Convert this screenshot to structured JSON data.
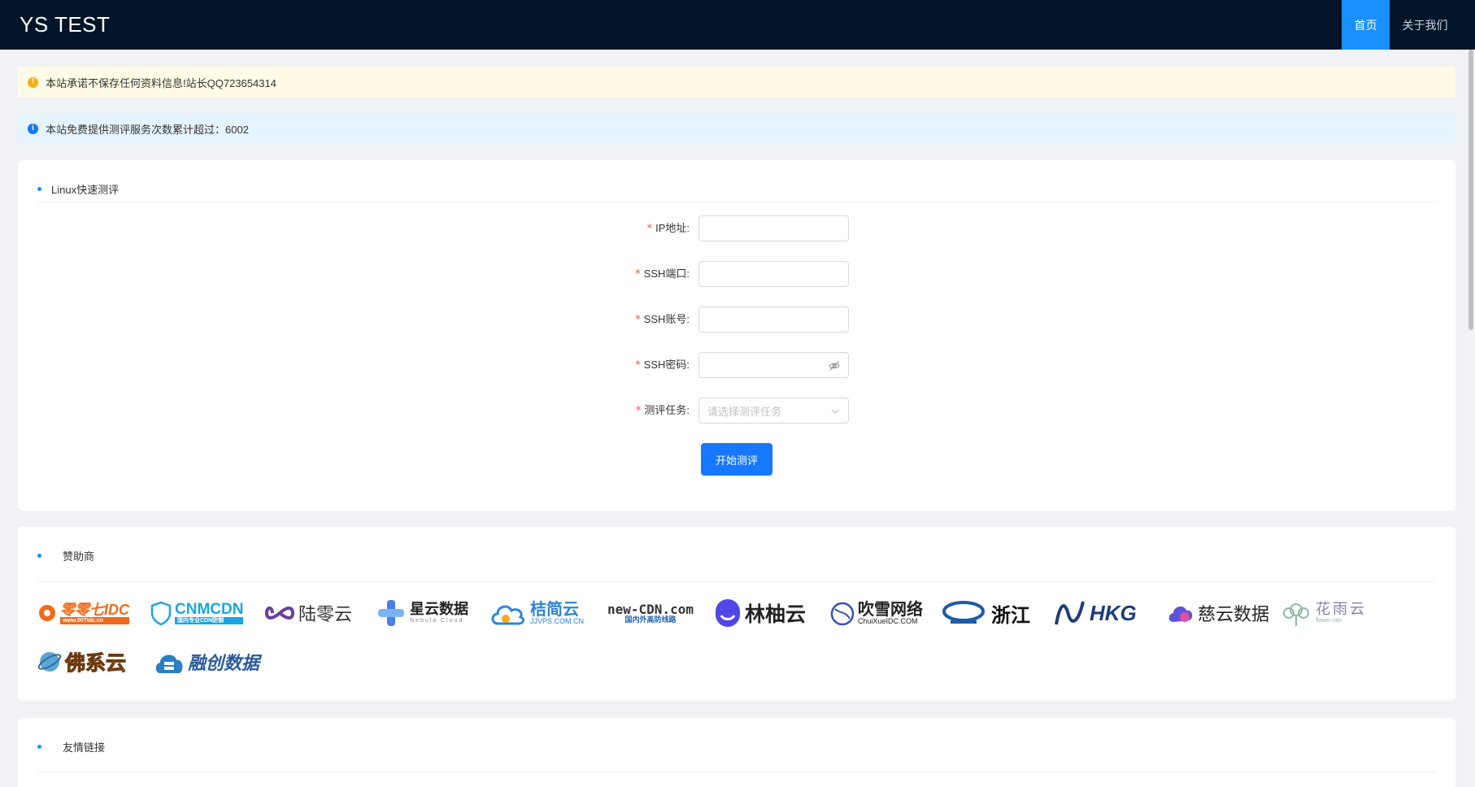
{
  "header": {
    "brand": "YS TEST",
    "nav": [
      {
        "label": "首页",
        "active": true
      },
      {
        "label": "关于我们",
        "active": false
      }
    ]
  },
  "alerts": {
    "warning": "本站承诺不保存任何资料信息!站长QQ723654314",
    "info": "本站免费提供测评服务次数累计超过：6002"
  },
  "test_card": {
    "title": "Linux快速测评",
    "fields": [
      {
        "label": "IP地址:",
        "value": ""
      },
      {
        "label": "SSH端口:",
        "value": ""
      },
      {
        "label": "SSH账号:",
        "value": ""
      },
      {
        "label": "SSH密码:",
        "value": ""
      },
      {
        "label": "测评任务:",
        "placeholder": "请选择测评任务"
      }
    ],
    "required_mark": "*",
    "submit_label": "开始测评"
  },
  "sponsors": {
    "title": "赞助商",
    "items": [
      {
        "name": "零零七IDC",
        "sub": "www.007idc.cn"
      },
      {
        "name": "CNMCDN",
        "sub": "国内专业CDN防御"
      },
      {
        "name": "陆零云"
      },
      {
        "name": "星云数据",
        "sub": "Nebula Cloud"
      },
      {
        "name": "桔简云",
        "sub": "JJVPS.COM.CN"
      },
      {
        "name": "new-CDN.com",
        "sub": "国内外高防线路"
      },
      {
        "name": "林柚云"
      },
      {
        "name": "吹雪网络",
        "sub": "ChuiXueIDC.COM"
      },
      {
        "name": "浙江"
      },
      {
        "name": "HKG"
      },
      {
        "name": "慈云数据"
      },
      {
        "name": "花雨云",
        "sub": "flower rain"
      },
      {
        "name": "佛系云"
      },
      {
        "name": "融创数据"
      }
    ]
  },
  "links_card": {
    "title": "友情链接"
  },
  "colors": {
    "header_bg": "#001529",
    "primary": "#1677ff",
    "warning": "#faad14",
    "required": "#ff4d4f"
  }
}
